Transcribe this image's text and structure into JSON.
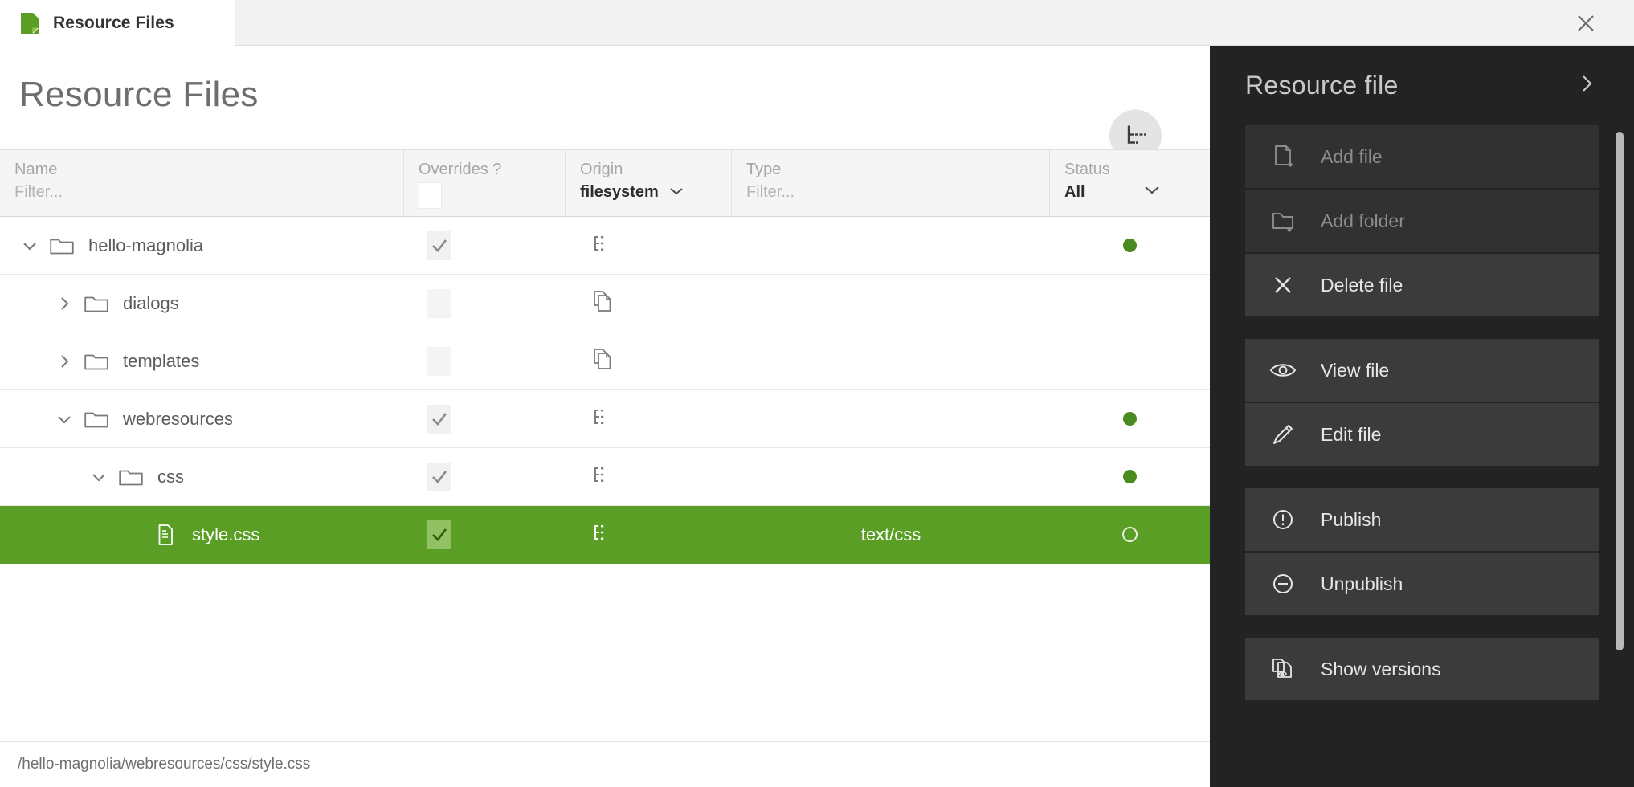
{
  "tab": {
    "label": "Resource Files",
    "icon": "resource-file-icon",
    "close_icon": "close-icon",
    "accent": "#5a9e25"
  },
  "page": {
    "title": "Resource Files",
    "viewmode_icon": "tree-view-icon"
  },
  "table": {
    "columns": [
      {
        "key": "name",
        "label": "Name",
        "filter_placeholder": "Filter...",
        "control": "text"
      },
      {
        "key": "overrides",
        "label": "Overrides ?",
        "filter_placeholder": "",
        "control": "checkbox"
      },
      {
        "key": "origin",
        "label": "Origin",
        "value": "filesystem",
        "control": "select"
      },
      {
        "key": "type",
        "label": "Type",
        "filter_placeholder": "Filter...",
        "control": "text"
      },
      {
        "key": "status",
        "label": "Status",
        "value": "All",
        "control": "select"
      }
    ],
    "rows": [
      {
        "name": "hello-magnolia",
        "depth": 0,
        "icon": "folder-icon",
        "expanded": true,
        "has_children": true,
        "overrides": "checked",
        "origin_icon": "filesystem-origin-icon",
        "type": "",
        "status": "published",
        "selected": false
      },
      {
        "name": "dialogs",
        "depth": 1,
        "icon": "folder-icon",
        "expanded": false,
        "has_children": true,
        "overrides": "unchecked",
        "origin_icon": "copy-origin-icon",
        "type": "",
        "status": "none",
        "selected": false
      },
      {
        "name": "templates",
        "depth": 1,
        "icon": "folder-icon",
        "expanded": false,
        "has_children": true,
        "overrides": "unchecked",
        "origin_icon": "copy-origin-icon",
        "type": "",
        "status": "none",
        "selected": false
      },
      {
        "name": "webresources",
        "depth": 1,
        "icon": "folder-icon",
        "expanded": true,
        "has_children": true,
        "overrides": "checked",
        "origin_icon": "filesystem-origin-icon",
        "type": "",
        "status": "published",
        "selected": false
      },
      {
        "name": "css",
        "depth": 2,
        "icon": "folder-icon",
        "expanded": true,
        "has_children": true,
        "overrides": "checked",
        "origin_icon": "filesystem-origin-icon",
        "type": "",
        "status": "published",
        "selected": false
      },
      {
        "name": "style.css",
        "depth": 3,
        "icon": "file-icon",
        "expanded": false,
        "has_children": false,
        "overrides": "checked",
        "origin_icon": "filesystem-origin-icon",
        "type": "text/css",
        "status": "modified",
        "selected": true
      }
    ]
  },
  "footer": {
    "path": "/hello-magnolia/webresources/css/style.css"
  },
  "panel": {
    "title": "Resource file",
    "collapse_icon": "chevron-right-icon",
    "groups": [
      {
        "actions": [
          {
            "label": "Add file",
            "icon": "add-file-icon",
            "disabled": true
          },
          {
            "label": "Add folder",
            "icon": "add-folder-icon",
            "disabled": true
          },
          {
            "label": "Delete file",
            "icon": "close-x-icon",
            "disabled": false
          }
        ]
      },
      {
        "actions": [
          {
            "label": "View file",
            "icon": "eye-icon",
            "disabled": false
          },
          {
            "label": "Edit file",
            "icon": "pencil-icon",
            "disabled": false
          }
        ]
      },
      {
        "actions": [
          {
            "label": "Publish",
            "icon": "info-circle-icon",
            "disabled": false
          },
          {
            "label": "Unpublish",
            "icon": "minus-circle-icon",
            "disabled": false
          }
        ]
      },
      {
        "actions": [
          {
            "label": "Show versions",
            "icon": "versions-icon",
            "disabled": false
          }
        ]
      }
    ]
  }
}
